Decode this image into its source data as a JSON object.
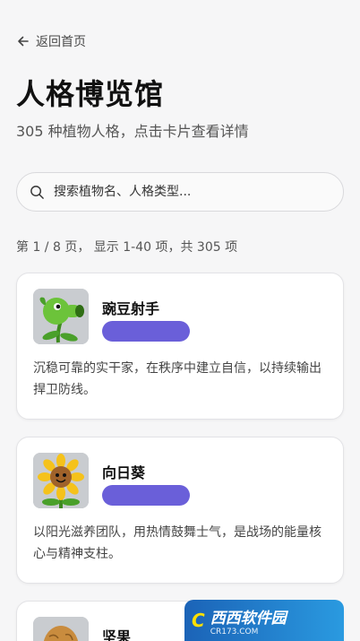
{
  "nav": {
    "back_label": "返回首页"
  },
  "header": {
    "title": "人格博览馆",
    "subtitle": "305 种植物人格，点击卡片查看详情"
  },
  "search": {
    "placeholder": "搜索植物名、人格类型..."
  },
  "pagination": {
    "summary": "第 1 / 8 页， 显示 1-40 项，共 305 项"
  },
  "colors": {
    "tag": "#6a5fd9",
    "accent": "#6a5fd9"
  },
  "cards": [
    {
      "name": "豌豆射手",
      "icon": "peashooter-icon",
      "description": "沉稳可靠的实干家，在秩序中建立自信，以持续输出捍卫防线。"
    },
    {
      "name": "向日葵",
      "icon": "sunflower-icon",
      "description": "以阳光滋养团队，用热情鼓舞士气，是战场的能量核心与精神支柱。"
    },
    {
      "name": "坚果",
      "icon": "wallnut-icon",
      "description": ""
    }
  ],
  "watermark": {
    "brand": "西西软件园",
    "url": "CR173.COM"
  }
}
